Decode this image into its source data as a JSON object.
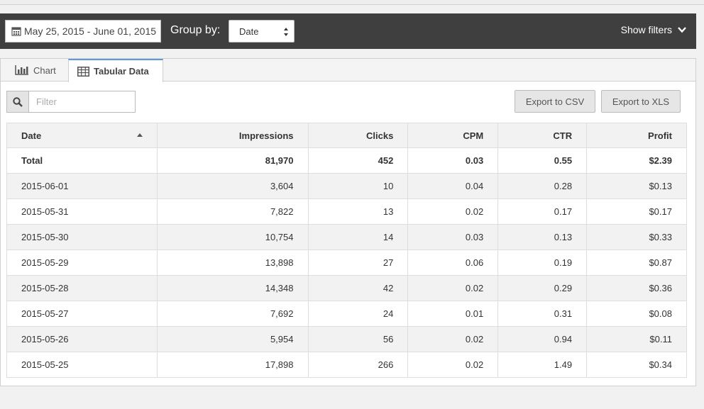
{
  "toolbar": {
    "date_range": "May 25, 2015 - June 01, 2015",
    "group_by_label": "Group by:",
    "group_by_value": "Date",
    "show_filters": "Show filters"
  },
  "tabs": [
    {
      "label": "Chart",
      "icon": "bar-chart-icon"
    },
    {
      "label": "Tabular Data",
      "icon": "table-icon",
      "active": true
    }
  ],
  "filter": {
    "placeholder": "Filter",
    "value": ""
  },
  "export": {
    "csv": "Export to CSV",
    "xls": "Export to XLS"
  },
  "table": {
    "columns": [
      "Date",
      "Impressions",
      "Clicks",
      "CPM",
      "CTR",
      "Profit"
    ],
    "total": [
      "Total",
      "81,970",
      "452",
      "0.03",
      "0.55",
      "$2.39"
    ],
    "rows": [
      [
        "2015-06-01",
        "3,604",
        "10",
        "0.04",
        "0.28",
        "$0.13"
      ],
      [
        "2015-05-31",
        "7,822",
        "13",
        "0.02",
        "0.17",
        "$0.17"
      ],
      [
        "2015-05-30",
        "10,754",
        "14",
        "0.03",
        "0.13",
        "$0.33"
      ],
      [
        "2015-05-29",
        "13,898",
        "27",
        "0.06",
        "0.19",
        "$0.87"
      ],
      [
        "2015-05-28",
        "14,348",
        "42",
        "0.02",
        "0.29",
        "$0.36"
      ],
      [
        "2015-05-27",
        "7,692",
        "24",
        "0.01",
        "0.31",
        "$0.08"
      ],
      [
        "2015-05-26",
        "5,954",
        "56",
        "0.02",
        "0.94",
        "$0.11"
      ],
      [
        "2015-05-25",
        "17,898",
        "266",
        "0.02",
        "1.49",
        "$0.34"
      ]
    ]
  },
  "colors": {
    "toolbar_bg": "#3f3f3f",
    "active_tab_accent": "#5b9bd5"
  }
}
